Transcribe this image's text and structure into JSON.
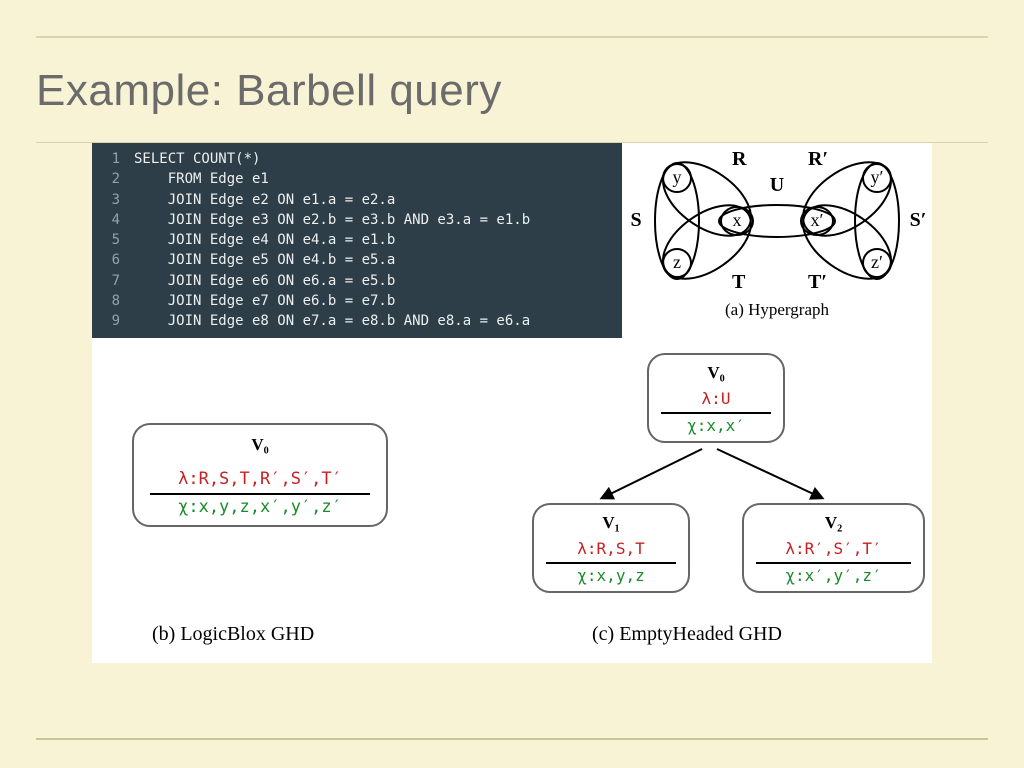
{
  "title": "Example: Barbell query",
  "code": {
    "lines": [
      {
        "n": "1",
        "text": "SELECT COUNT(*)"
      },
      {
        "n": "2",
        "text": "    FROM Edge e1"
      },
      {
        "n": "3",
        "text": "    JOIN Edge e2 ON e1.a = e2.a"
      },
      {
        "n": "4",
        "text": "    JOIN Edge e3 ON e2.b = e3.b AND e3.a = e1.b"
      },
      {
        "n": "5",
        "text": "    JOIN Edge e4 ON e4.a = e1.b"
      },
      {
        "n": "6",
        "text": "    JOIN Edge e5 ON e4.b = e5.a"
      },
      {
        "n": "7",
        "text": "    JOIN Edge e6 ON e6.a = e5.b"
      },
      {
        "n": "8",
        "text": "    JOIN Edge e7 ON e6.b = e7.b"
      },
      {
        "n": "9",
        "text": "    JOIN Edge e8 ON e7.a = e8.b AND e8.a = e6.a"
      }
    ]
  },
  "hypergraph": {
    "caption": "(a) Hypergraph",
    "left_vars": {
      "top": "y",
      "mid": "x",
      "bot": "z"
    },
    "right_vars": {
      "top": "y′",
      "mid": "x′",
      "bot": "z′"
    },
    "edge_labels": {
      "R": "R",
      "S": "S",
      "T": "T",
      "U": "U",
      "Rp": "R′",
      "Sp": "S′",
      "Tp": "T′"
    }
  },
  "ghd_b": {
    "caption": "(b) LogicBlox GHD",
    "node": {
      "v": "V₀",
      "lambda": "λ:R,S,T,R′,S′,T′",
      "chi": "χ:x,y,z,x′,y′,z′"
    }
  },
  "ghd_c": {
    "caption": "(c) EmptyHeaded GHD",
    "root": {
      "v": "V₀",
      "lambda": "λ:U",
      "chi": "χ:x,x′"
    },
    "left": {
      "v": "V₁",
      "lambda": "λ:R,S,T",
      "chi": "χ:x,y,z"
    },
    "right": {
      "v": "V₂",
      "lambda": "λ:R′,S′,T′",
      "chi": "χ:x′,y′,z′"
    }
  }
}
